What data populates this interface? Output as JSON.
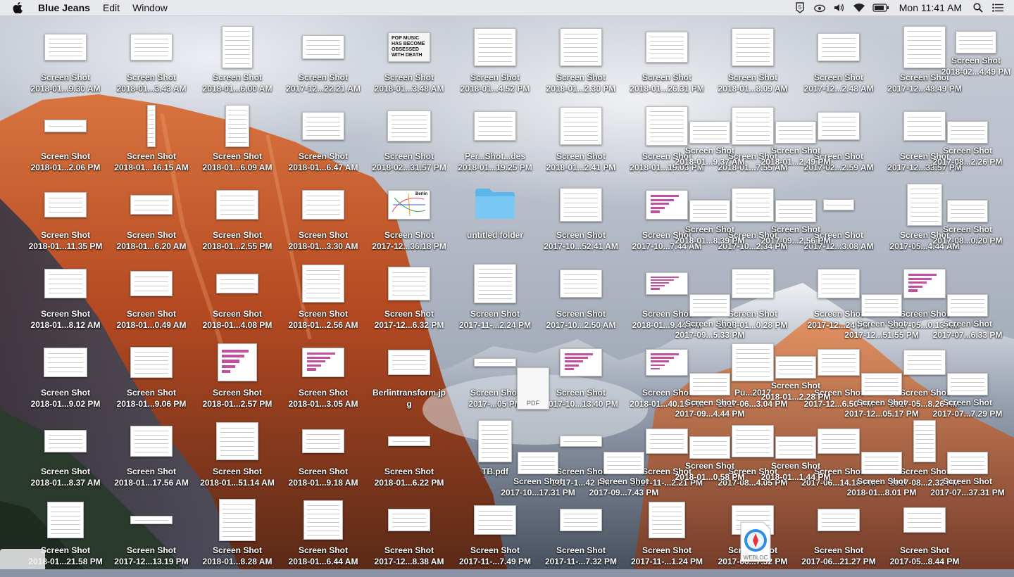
{
  "menubar": {
    "app_name": "Blue Jeans",
    "menus": [
      "Edit",
      "Window"
    ],
    "status_icons": [
      "apple-icon",
      "bluejeans-icon",
      "creative-cloud-icon",
      "volume-icon",
      "wifi-icon",
      "battery-icon",
      "spotlight-search-icon",
      "notification-center-icon"
    ],
    "clock": "Mon 11:41 AM"
  },
  "desktop": {
    "columns": [
      [
        [
          "Screen Shot",
          "2018-01...9.30 AM"
        ],
        [
          "Screen Shot",
          "2018-01...2.06 PM"
        ],
        [
          "Screen Shot",
          "2018-01...11.35 PM"
        ],
        [
          "Screen Shot",
          "2018-01...8.12 AM"
        ],
        [
          "Screen Shot",
          "2018-01...9.02 PM"
        ],
        [
          "Screen Shot",
          "2018-01...8.37 AM"
        ],
        [
          "Screen Shot",
          "2018-01...21.58 PM"
        ]
      ],
      [
        [
          "Screen Shot",
          "2018-01...3.43 AM"
        ],
        [
          "Screen Shot",
          "2018-01...16.15 AM"
        ],
        [
          "Screen Shot",
          "2018-01...6.20 AM"
        ],
        [
          "Screen Shot",
          "2018-01...0.49 AM"
        ],
        [
          "Screen Shot",
          "2018-01...9.06 PM"
        ],
        [
          "Screen Shot",
          "2018-01...17.56 AM"
        ],
        [
          "Screen Shot",
          "2017-12...13.19 PM"
        ]
      ],
      [
        [
          "Screen Shot",
          "2018-01...6.00 AM"
        ],
        [
          "Screen Shot",
          "2018-01...6.09 AM"
        ],
        [
          "Screen Shot",
          "2018-01...2.55 PM"
        ],
        [
          "Screen Shot",
          "2018-01...4.08 PM"
        ],
        [
          "Screen Shot",
          "2018-01...2.57 PM"
        ],
        [
          "Screen Shot",
          "2018-01...51.14 AM"
        ],
        [
          "Screen Shot",
          "2018-01...8.28 AM"
        ]
      ],
      [
        [
          "Screen Shot",
          "2017-12...22.21 AM"
        ],
        [
          "Screen Shot",
          "2018-01...6.47 AM"
        ],
        [
          "Screen Shot",
          "2018-01...3.30 AM"
        ],
        [
          "Screen Shot",
          "2018-01...2.56 AM"
        ],
        [
          "Screen Shot",
          "2018-01...3.05 AM"
        ],
        [
          "Screen Shot",
          "2018-01...9.18 AM"
        ],
        [
          "Screen Shot",
          "2018-01...6.44 AM"
        ]
      ],
      [
        [
          "Screen Shot",
          "2018-01...3.48 AM"
        ],
        [
          "Screen Shot",
          "2018-02...31.57 PM"
        ],
        [
          "Screen Shot",
          "2017-12...36.18 PM"
        ],
        [
          "Screen Shot",
          "2017-12...6.32 PM"
        ],
        [
          "Berlintransform.jp",
          "g"
        ],
        [
          "Screen Shot",
          "2018-01...6.22 PM"
        ],
        [
          "Screen Shot",
          "2017-12...8.38 AM"
        ]
      ],
      [
        [
          "Screen Shot",
          "2018-01...4.52 PM"
        ],
        [
          "Per...Shot...des",
          "2018-01...19.25 PM"
        ],
        [
          "untitled folder",
          ""
        ],
        [
          "Screen Shot",
          "2017-11-...2.24 PM"
        ],
        [
          "Screen Shot",
          "2017-...05 PM"
        ],
        [
          "TB.pdf",
          ""
        ],
        [
          "Screen Shot",
          "2017-11-...7.49 PM"
        ]
      ],
      [
        [
          "Screen Shot",
          "2018-01...2.30 PM"
        ],
        [
          "Screen Shot",
          "2018-01...2.41 PM"
        ],
        [
          "Screen Shot",
          "2017-10...52.41 AM"
        ],
        [
          "Screen Shot",
          "2017-10...2.50 AM"
        ],
        [
          "Screen Shot",
          "2017-10...13.40 PM"
        ],
        [
          "Screen Shot",
          "2017-1...42 PM"
        ],
        [
          "Screen Shot",
          "2017-11-...7.32 PM"
        ]
      ],
      [
        [
          "Screen Shot",
          "2018-01...26.31 PM"
        ],
        [
          "Screen Shot",
          "2018-01...19.03 PM"
        ],
        [
          "Screen Shot",
          "2017-10...7.44 AM"
        ],
        [
          "Screen Shot",
          "2018-01...9.44 PM"
        ],
        [
          "Screen Shot",
          "2018-01...40.15 PM"
        ],
        [
          "Screen Shot",
          "2017-11-...2.21 PM"
        ],
        [
          "Screen Shot",
          "2017-11-...1.24 PM"
        ]
      ],
      [
        [
          "Screen Shot",
          "2018-01...8.09 AM"
        ],
        [
          "Screen Shot",
          "2018-01...7.55 AM"
        ],
        [
          "Screen Shot",
          "2017-10...2.34 PM"
        ],
        [
          "Screen Shot",
          "2018-01...0.28 PM"
        ],
        [
          "Pu...2017",
          "2017-06...3.04 PM"
        ],
        [
          "Screen Shot",
          "2017-08...4.05 PM"
        ],
        [
          "Screen Shot",
          "2017-06...7.32 PM"
        ]
      ],
      [
        [
          "Screen Shot",
          "2017-12...2.48 AM"
        ],
        [
          "Screen Shot",
          "2017-02...2.59 AM"
        ],
        [
          "Screen Shot",
          "2017-12...3.08 AM"
        ],
        [
          "Screen Shot",
          "2017-12...24 PM"
        ],
        [
          "Screen Shot",
          "2017-12...6.50 PM"
        ],
        [
          "Screen Shot",
          "2017-06...14.18 PM"
        ],
        [
          "Screen Shot",
          "2017-06...21.27 PM"
        ]
      ],
      [
        [
          "Screen Shot",
          "2017-12...48.49 PM"
        ],
        [
          "Screen Shot",
          "2017-12...33.57 PM"
        ],
        [
          "Screen Shot",
          "2017-05...4.44 AM"
        ],
        [
          "Screen Shot",
          "2017-05...0.13 AM"
        ],
        [
          "Screen Shot",
          "2017-05...8.26 AM"
        ],
        [
          "Screen Shot",
          "2017-08...2.32 PM"
        ],
        [
          "Screen Shot",
          "2017-05...8.44 PM"
        ]
      ]
    ],
    "overlay_labels": [
      [
        "Screen Shot",
        "2018-02...4.49 PM"
      ],
      [
        "Screen Shot",
        "2018-01...9.37 AM"
      ],
      [
        "Screen Shot",
        "2018-01...2.49 PM"
      ],
      [
        "Screen Shot",
        "2017-08...2.26 PM"
      ],
      [
        "Screen Shot",
        "2018-01...8.39 PM"
      ],
      [
        "Screen Shot",
        "2017-09...2.56 PM"
      ],
      [
        "Screen Shot",
        "2017-08...0.20 PM"
      ],
      [
        "Screen Shot",
        "2017-09...5.33 PM"
      ],
      [
        "Screen Shot",
        "2017-07...6.33 PM"
      ],
      [
        "Screen Shot",
        "2017-12...51.55 PM"
      ],
      [
        "Screen Shot",
        "2017-09...4.44 PM"
      ],
      [
        "Screen Shot",
        "2017-12...05.17 PM"
      ],
      [
        "Screen Shot",
        "2017-07...7.29 PM"
      ],
      [
        "Screen Shot",
        "2018-01...0.58 PM"
      ],
      [
        "Screen Shot",
        "2018-01...1.44 PM"
      ],
      [
        "Screen Shot",
        "2017-10...17.31 PM"
      ],
      [
        "Screen Shot",
        "2017-09...7.43 PM"
      ],
      [
        "Screen Shot",
        "2018-01...8.01 PM"
      ],
      [
        "Screen Shot",
        "2017-07...37.31 PM"
      ],
      [
        "Screen Shot",
        "2018-01...2.28 PM"
      ]
    ],
    "file_badges": {
      "pdf": "PDF",
      "webloc": "WEBLOC"
    },
    "thumbnail_texts": {
      "pop_music": "POP MUSIC HAS BECOME OBSESSED WITH DEATH",
      "berlin": "Berlin"
    }
  }
}
